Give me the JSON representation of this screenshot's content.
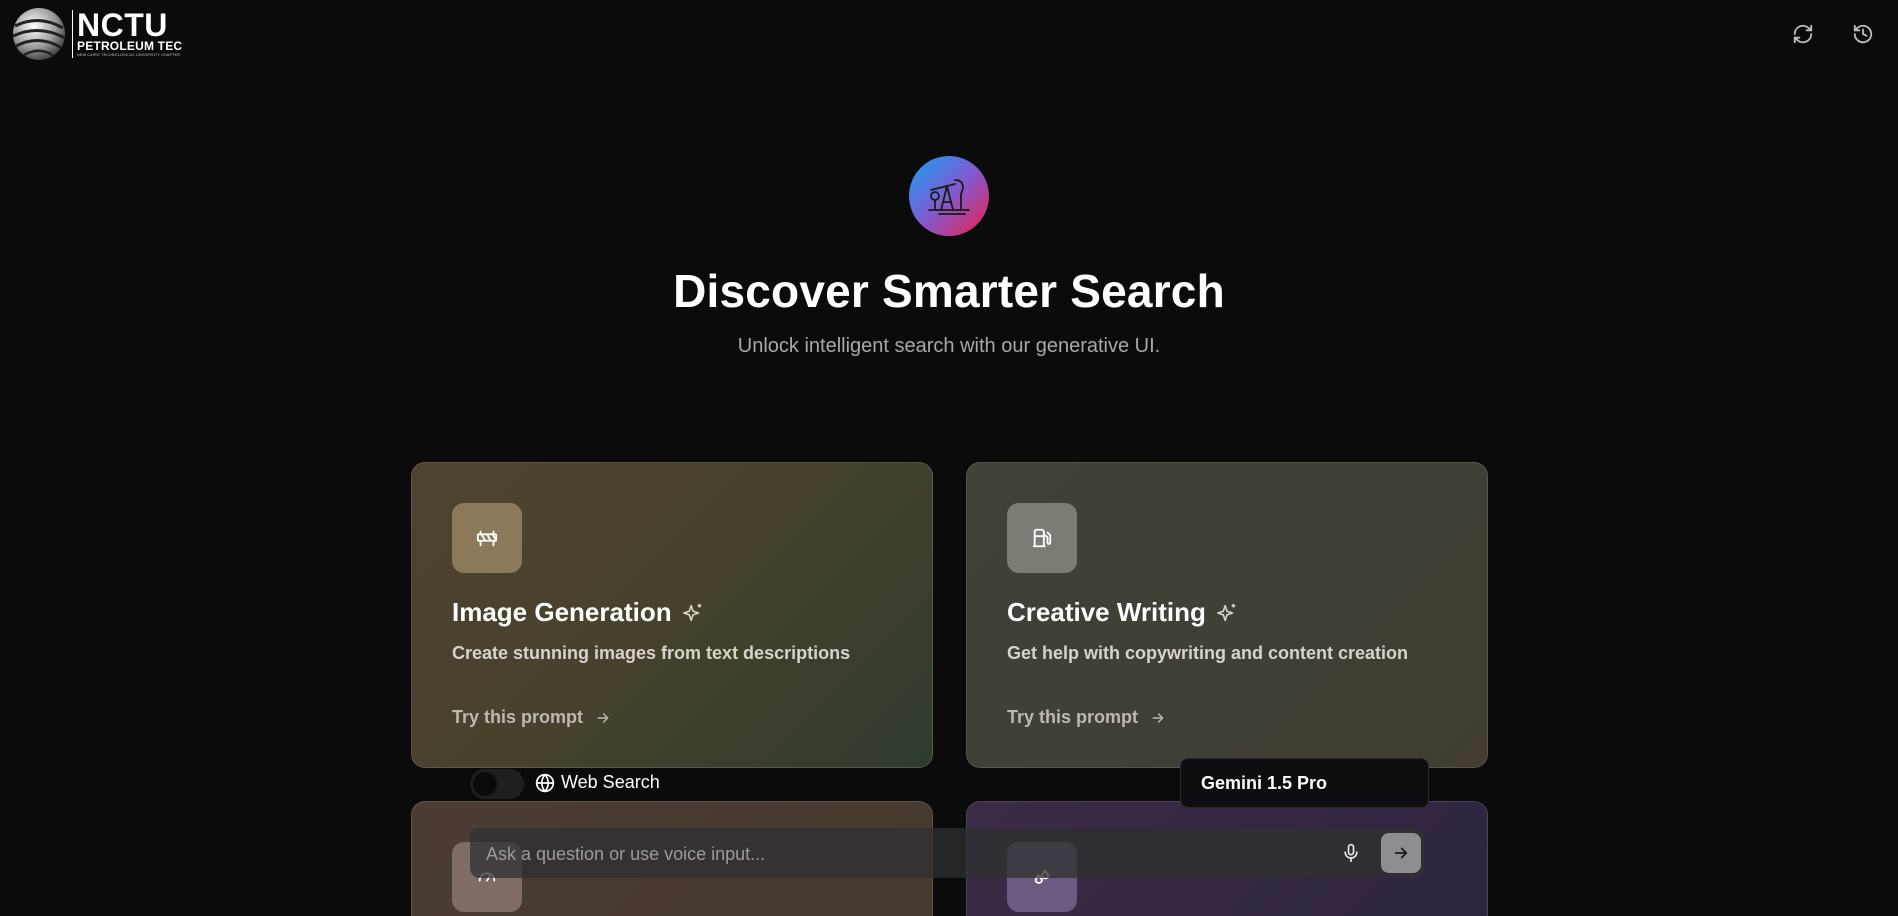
{
  "header": {
    "logo_title": "NCTU",
    "logo_subtitle": "PETROLEUM TEC",
    "logo_tagline": "NEW CAIRO TECHNOLOGICAL UNIVERSITY CHAPTER",
    "refresh_icon": "refresh-icon",
    "history_icon": "history-icon"
  },
  "hero": {
    "icon": "oil-pumpjack-icon",
    "title": "Discover Smarter Search",
    "subtitle": "Unlock intelligent search with our generative UI."
  },
  "cards": [
    {
      "icon": "barrier-icon",
      "title": "Image Generation",
      "title_icon": "sparkles-icon",
      "description": "Create stunning images from text descriptions",
      "link": "Try this prompt"
    },
    {
      "icon": "fuel-icon",
      "title": "Creative Writing",
      "title_icon": "sparkles-icon",
      "description": "Get help with copywriting and content creation",
      "link": "Try this prompt"
    },
    {
      "icon": "gauge-icon"
    },
    {
      "icon": "droplets-icon"
    }
  ],
  "controls": {
    "web_search_label": "Web Search",
    "web_search_enabled": false,
    "model_name": "Gemini 1.5 Pro",
    "input_placeholder": "Ask a question or use voice input...",
    "input_value": ""
  }
}
